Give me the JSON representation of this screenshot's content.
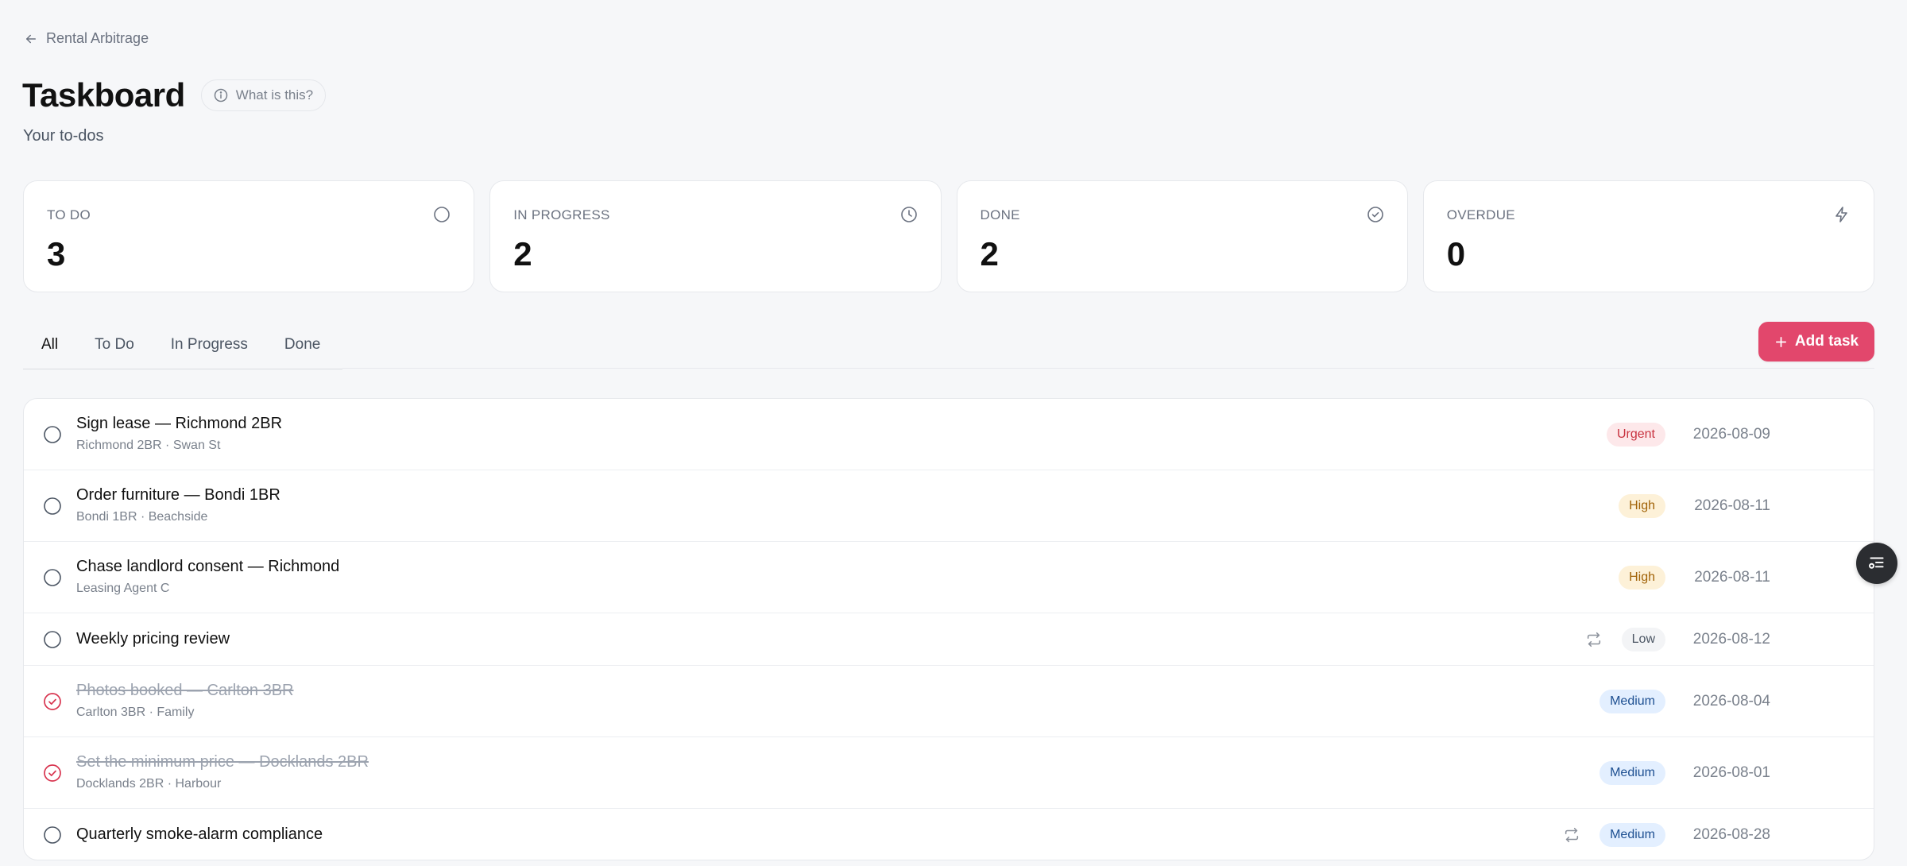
{
  "back_link": {
    "label": "Rental Arbitrage",
    "icon": "arrow-left-icon"
  },
  "header": {
    "title": "Taskboard",
    "info_label": "What is this?",
    "subtitle": "Your to-dos"
  },
  "stats": [
    {
      "label": "TO DO",
      "value": "3",
      "icon": "circle-icon"
    },
    {
      "label": "IN PROGRESS",
      "value": "2",
      "icon": "clock-icon"
    },
    {
      "label": "DONE",
      "value": "2",
      "icon": "check-circle-icon"
    },
    {
      "label": "OVERDUE",
      "value": "0",
      "icon": "lightning-icon"
    }
  ],
  "tabs": [
    {
      "label": "All",
      "active": true
    },
    {
      "label": "To Do",
      "active": false
    },
    {
      "label": "In Progress",
      "active": false
    },
    {
      "label": "Done",
      "active": false
    }
  ],
  "add_task_label": "Add task",
  "colors": {
    "accent": "#e2476c",
    "urgent": "#c8323f",
    "high": "#a16207",
    "medium": "#1d4f91",
    "done_check": "#d8344f"
  },
  "tasks": [
    {
      "title": "Sign lease — Richmond 2BR",
      "subtitle": "Richmond 2BR · Swan St",
      "priority": "Urgent",
      "date": "2026-08-09",
      "done": false,
      "recurring": false
    },
    {
      "title": "Order furniture — Bondi 1BR",
      "subtitle": "Bondi 1BR · Beachside",
      "priority": "High",
      "date": "2026-08-11",
      "done": false,
      "recurring": false
    },
    {
      "title": "Chase landlord consent — Richmond",
      "subtitle": "Leasing Agent C",
      "priority": "High",
      "date": "2026-08-11",
      "done": false,
      "recurring": false
    },
    {
      "title": "Weekly pricing review",
      "subtitle": "",
      "priority": "Low",
      "date": "2026-08-12",
      "done": false,
      "recurring": true
    },
    {
      "title": "Photos booked — Carlton 3BR",
      "subtitle": "Carlton 3BR · Family",
      "priority": "Medium",
      "date": "2026-08-04",
      "done": true,
      "recurring": false
    },
    {
      "title": "Set the minimum price — Docklands 2BR",
      "subtitle": "Docklands 2BR · Harbour",
      "priority": "Medium",
      "date": "2026-08-01",
      "done": true,
      "recurring": false
    },
    {
      "title": "Quarterly smoke-alarm compliance",
      "subtitle": "",
      "priority": "Medium",
      "date": "2026-08-28",
      "done": false,
      "recurring": true
    }
  ]
}
